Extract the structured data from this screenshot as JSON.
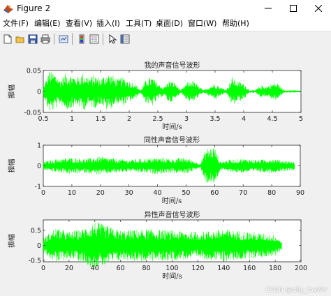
{
  "window": {
    "title": "Figure 2",
    "minimize_icon": "minimize-icon",
    "maximize_icon": "maximize-icon",
    "close_icon": "close-icon"
  },
  "menu": [
    {
      "label": "文件(F)"
    },
    {
      "label": "编辑(E)"
    },
    {
      "label": "查看(V)"
    },
    {
      "label": "插入(I)"
    },
    {
      "label": "工具(T)"
    },
    {
      "label": "桌面(D)"
    },
    {
      "label": "窗口(W)"
    },
    {
      "label": "帮助(H)"
    }
  ],
  "toolbar": [
    {
      "icon": "new-figure-icon"
    },
    {
      "icon": "open-file-icon"
    },
    {
      "icon": "save-icon"
    },
    {
      "icon": "print-icon"
    },
    {
      "icon": "link-plot-icon"
    },
    {
      "icon": "colorbar-icon"
    },
    {
      "icon": "legend-icon"
    },
    {
      "icon": "edit-plot-icon"
    },
    {
      "icon": "property-editor-icon"
    }
  ],
  "watermark": "CSDN @silly_foxWY",
  "colors": {
    "signal": "#00ff00",
    "axes_bg": "#ffffff",
    "figure_bg": "#f0f0f0"
  },
  "chart_data": [
    {
      "type": "line",
      "title": "我的声音信号波形",
      "xlabel": "时间/s",
      "ylabel": "振幅",
      "xlim": [
        0.5,
        5
      ],
      "ylim": [
        -0.05,
        0.05
      ],
      "xticks": [
        "0.5",
        "1",
        "1.5",
        "2",
        "2.5",
        "3",
        "3.5",
        "4",
        "4.5",
        "5"
      ],
      "yticks": [
        "0.05",
        "0",
        "-0.05"
      ],
      "envelope": {
        "t": [
          0.5,
          0.6,
          0.7,
          0.8,
          0.9,
          1.0,
          1.1,
          1.2,
          1.3,
          1.4,
          1.5,
          1.6,
          1.7,
          1.8,
          1.9,
          2.0,
          2.1,
          2.2,
          2.3,
          2.4,
          2.5,
          2.6,
          2.7,
          2.8,
          2.9,
          3.0,
          3.1,
          3.2,
          3.3,
          3.4,
          3.5,
          3.6,
          3.7,
          3.8,
          3.9,
          4.0,
          4.1,
          4.2,
          4.3,
          4.4,
          4.5,
          4.6,
          4.7,
          4.8,
          4.9,
          5.0
        ],
        "amplitude": [
          0.01,
          0.05,
          0.045,
          0.03,
          0.045,
          0.04,
          0.035,
          0.045,
          0.035,
          0.04,
          0.03,
          0.045,
          0.04,
          0.03,
          0.035,
          0.025,
          0.02,
          0.003,
          0.03,
          0.035,
          0.02,
          0.01,
          0.028,
          0.022,
          0.003,
          0.02,
          0.028,
          0.015,
          0.003,
          0.012,
          0.02,
          0.01,
          0.005,
          0.035,
          0.025,
          0.02,
          0.003,
          0.003,
          0.015,
          0.012,
          0.02,
          0.02,
          0.003,
          0.003,
          0.003,
          0.002
        ]
      }
    },
    {
      "type": "line",
      "title": "同性声音信号波形",
      "xlabel": "时间/s",
      "ylabel": "振幅",
      "xlim": [
        0,
        90
      ],
      "ylim": [
        -1,
        1
      ],
      "xticks": [
        "0",
        "10",
        "20",
        "30",
        "40",
        "50",
        "60",
        "70",
        "80",
        "90"
      ],
      "yticks": [
        "1",
        "0",
        "-1"
      ],
      "envelope": {
        "t": [
          0,
          5,
          10,
          15,
          20,
          25,
          30,
          35,
          40,
          45,
          50,
          55,
          57,
          60,
          62,
          65,
          70,
          75,
          80,
          85,
          88
        ],
        "amplitude": [
          0.2,
          0.35,
          0.4,
          0.35,
          0.45,
          0.35,
          0.3,
          0.35,
          0.4,
          0.35,
          0.4,
          0.1,
          0.85,
          0.95,
          0.2,
          0.3,
          0.35,
          0.3,
          0.35,
          0.25,
          0.2
        ]
      }
    },
    {
      "type": "line",
      "title": "异性声音信号波形",
      "xlabel": "时间/s",
      "ylabel": "振幅",
      "xlim": [
        0,
        200
      ],
      "ylim": [
        -0.55,
        0.85
      ],
      "xticks": [
        "0",
        "20",
        "40",
        "60",
        "80",
        "100",
        "120",
        "140",
        "160",
        "180",
        "200"
      ],
      "yticks": [
        "0.5",
        "0",
        "-0.5"
      ],
      "envelope": {
        "t": [
          0,
          10,
          20,
          30,
          40,
          60,
          80,
          100,
          120,
          140,
          160,
          180,
          185
        ],
        "amplitude": [
          0.25,
          0.6,
          0.45,
          0.55,
          0.8,
          0.5,
          0.55,
          0.5,
          0.45,
          0.55,
          0.45,
          0.35,
          0.15
        ]
      }
    }
  ]
}
